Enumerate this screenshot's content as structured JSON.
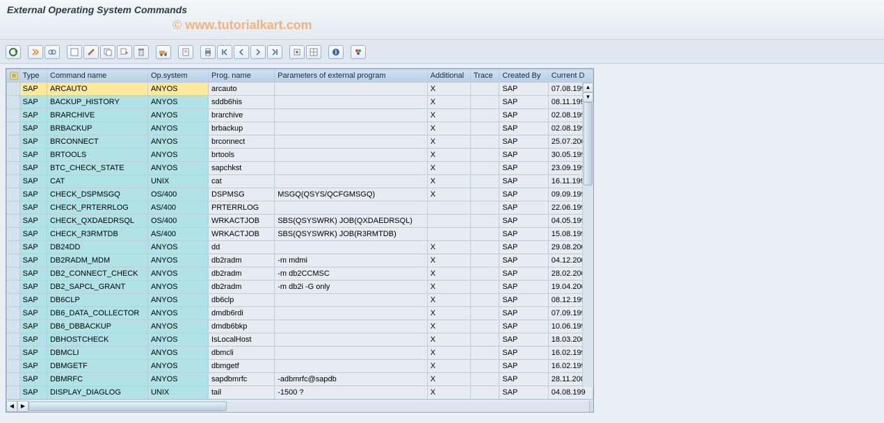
{
  "title": "External Operating System Commands",
  "watermark": "www.tutorialkart.com",
  "toolbar": {
    "icons": [
      "refresh-icon",
      "execute-icon",
      "display-icon",
      "create-icon",
      "change-icon",
      "copy-icon",
      "transport-icon",
      "delete-icon",
      "truck-icon",
      "doc-icon",
      "print-icon",
      "first-page-icon",
      "prev-page-icon",
      "next-page-icon",
      "last-page-icon",
      "export-icon",
      "spreadsheet-icon",
      "info-icon",
      "variant-icon"
    ]
  },
  "columns": {
    "sel": "",
    "type": "Type",
    "cmd": "Command name",
    "opsys": "Op.system",
    "prog": "Prog. name",
    "params": "Parameters of external program",
    "add": "Additional",
    "trace": "Trace",
    "cby": "Created By",
    "date": "Current D"
  },
  "rows": [
    {
      "type": "SAP",
      "cmd": "ARCAUTO",
      "opsys": "ANYOS",
      "prog": "arcauto",
      "params": "",
      "add": "X",
      "trace": "",
      "cby": "SAP",
      "date": "07.08.199",
      "sel": true
    },
    {
      "type": "SAP",
      "cmd": "BACKUP_HISTORY",
      "opsys": "ANYOS",
      "prog": "sddb6his",
      "params": "",
      "add": "X",
      "trace": "",
      "cby": "SAP",
      "date": "08.11.199"
    },
    {
      "type": "SAP",
      "cmd": "BRARCHIVE",
      "opsys": "ANYOS",
      "prog": "brarchive",
      "params": "",
      "add": "X",
      "trace": "",
      "cby": "SAP",
      "date": "02.08.199"
    },
    {
      "type": "SAP",
      "cmd": "BRBACKUP",
      "opsys": "ANYOS",
      "prog": "brbackup",
      "params": "",
      "add": "X",
      "trace": "",
      "cby": "SAP",
      "date": "02.08.199"
    },
    {
      "type": "SAP",
      "cmd": "BRCONNECT",
      "opsys": "ANYOS",
      "prog": "brconnect",
      "params": "",
      "add": "X",
      "trace": "",
      "cby": "SAP",
      "date": "25.07.200"
    },
    {
      "type": "SAP",
      "cmd": "BRTOOLS",
      "opsys": "ANYOS",
      "prog": "brtools",
      "params": "",
      "add": "X",
      "trace": "",
      "cby": "SAP",
      "date": "30.05.199"
    },
    {
      "type": "SAP",
      "cmd": "BTC_CHECK_STATE",
      "opsys": "ANYOS",
      "prog": "sapchkst",
      "params": "",
      "add": "X",
      "trace": "",
      "cby": "SAP",
      "date": "23.09.199"
    },
    {
      "type": "SAP",
      "cmd": "CAT",
      "opsys": "UNIX",
      "prog": "cat",
      "params": "",
      "add": "X",
      "trace": "",
      "cby": "SAP",
      "date": "16.11.199"
    },
    {
      "type": "SAP",
      "cmd": "CHECK_DSPMSGQ",
      "opsys": "OS/400",
      "prog": "DSPMSG",
      "params": "MSGQ(QSYS/QCFGMSGQ)",
      "add": "X",
      "trace": "",
      "cby": "SAP",
      "date": "09.09.199"
    },
    {
      "type": "SAP",
      "cmd": "CHECK_PRTERRLOG",
      "opsys": "AS/400",
      "prog": "PRTERRLOG",
      "params": "",
      "add": "",
      "trace": "",
      "cby": "SAP",
      "date": "22.06.199"
    },
    {
      "type": "SAP",
      "cmd": "CHECK_QXDAEDRSQL",
      "opsys": "OS/400",
      "prog": "WRKACTJOB",
      "params": "SBS(QSYSWRK) JOB(QXDAEDRSQL)",
      "add": "",
      "trace": "",
      "cby": "SAP",
      "date": "04.05.199"
    },
    {
      "type": "SAP",
      "cmd": "CHECK_R3RMTDB",
      "opsys": "AS/400",
      "prog": "WRKACTJOB",
      "params": "SBS(QSYSWRK) JOB(R3RMTDB)",
      "add": "",
      "trace": "",
      "cby": "SAP",
      "date": "15.08.199"
    },
    {
      "type": "SAP",
      "cmd": "DB24DD",
      "opsys": "ANYOS",
      "prog": "dd",
      "params": "",
      "add": "X",
      "trace": "",
      "cby": "SAP",
      "date": "29.08.200"
    },
    {
      "type": "SAP",
      "cmd": "DB2RADM_MDM",
      "opsys": "ANYOS",
      "prog": "db2radm",
      "params": "-m mdmi",
      "add": "X",
      "trace": "",
      "cby": "SAP",
      "date": "04.12.200"
    },
    {
      "type": "SAP",
      "cmd": "DB2_CONNECT_CHECK",
      "opsys": "ANYOS",
      "prog": "db2radm",
      "params": "-m db2CCMSC",
      "add": "X",
      "trace": "",
      "cby": "SAP",
      "date": "28.02.200"
    },
    {
      "type": "SAP",
      "cmd": "DB2_SAPCL_GRANT",
      "opsys": "ANYOS",
      "prog": "db2radm",
      "params": "-m db2i -G only",
      "add": "X",
      "trace": "",
      "cby": "SAP",
      "date": "19.04.200"
    },
    {
      "type": "SAP",
      "cmd": "DB6CLP",
      "opsys": "ANYOS",
      "prog": "db6clp",
      "params": "",
      "add": "X",
      "trace": "",
      "cby": "SAP",
      "date": "08.12.199"
    },
    {
      "type": "SAP",
      "cmd": "DB6_DATA_COLLECTOR",
      "opsys": "ANYOS",
      "prog": "dmdb6rdi",
      "params": "",
      "add": "X",
      "trace": "",
      "cby": "SAP",
      "date": "07.09.199"
    },
    {
      "type": "SAP",
      "cmd": "DB6_DBBACKUP",
      "opsys": "ANYOS",
      "prog": "dmdb6bkp",
      "params": "",
      "add": "X",
      "trace": "",
      "cby": "SAP",
      "date": "10.06.199"
    },
    {
      "type": "SAP",
      "cmd": "DBHOSTCHECK",
      "opsys": "ANYOS",
      "prog": "IsLocalHost",
      "params": "",
      "add": "X",
      "trace": "",
      "cby": "SAP",
      "date": "18.03.200"
    },
    {
      "type": "SAP",
      "cmd": "DBMCLI",
      "opsys": "ANYOS",
      "prog": "dbmcli",
      "params": "",
      "add": "X",
      "trace": "",
      "cby": "SAP",
      "date": "16.02.199"
    },
    {
      "type": "SAP",
      "cmd": "DBMGETF",
      "opsys": "ANYOS",
      "prog": "dbmgetf",
      "params": "",
      "add": "X",
      "trace": "",
      "cby": "SAP",
      "date": "16.02.199"
    },
    {
      "type": "SAP",
      "cmd": "DBMRFC",
      "opsys": "ANYOS",
      "prog": "sapdbmrfc",
      "params": "-adbmrfc@sapdb",
      "add": "X",
      "trace": "",
      "cby": "SAP",
      "date": "28.11.200"
    },
    {
      "type": "SAP",
      "cmd": "DISPLAY_DIAGLOG",
      "opsys": "UNIX",
      "prog": "tail",
      "params": "-1500 ?",
      "add": "X",
      "trace": "",
      "cby": "SAP",
      "date": "04.08.199"
    }
  ]
}
